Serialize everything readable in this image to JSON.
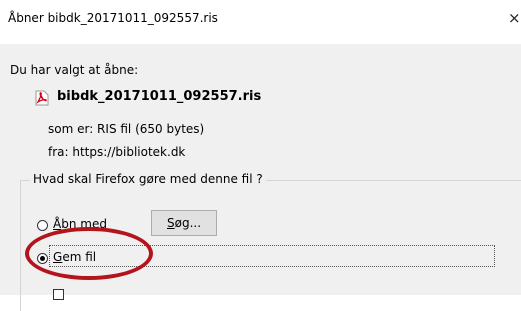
{
  "dialog": {
    "title": "Åbner bibdk_20171011_092557.ris",
    "close_glyph": "×"
  },
  "content": {
    "heading": "Du har valgt at åbne:",
    "file_icon": "pdf-file-icon",
    "filename": "bibdk_20171011_092557.ris",
    "type_line": "som er:  RIS fil (650 bytes)",
    "from_line": "fra:  https://bibliotek.dk"
  },
  "action_group": {
    "label": "Hvad skal Firefox gøre med denne fil ?",
    "open_with": {
      "accel": "Å",
      "rest": "bn med",
      "selected": false
    },
    "browse_button": {
      "accel": "S",
      "rest": "øg..."
    },
    "save_file": {
      "accel": "G",
      "rest": "em fil",
      "selected": true
    }
  },
  "annotation": {
    "color": "#b4141c"
  }
}
